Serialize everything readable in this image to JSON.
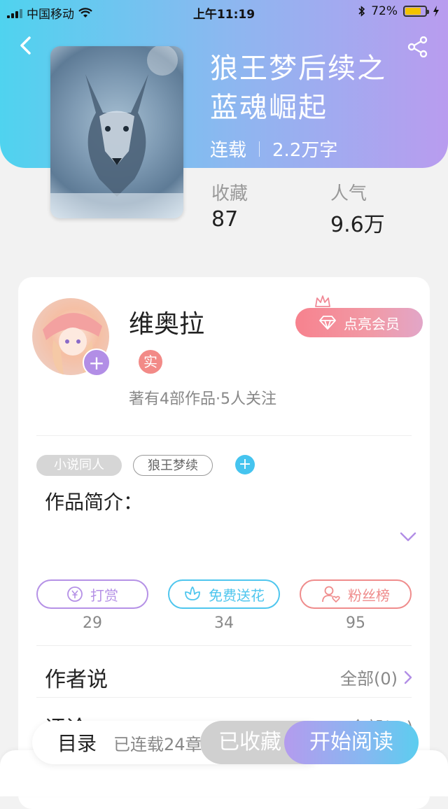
{
  "status_bar": {
    "carrier": "中国移动",
    "time": "上午11:19",
    "battery": "72%"
  },
  "book": {
    "title_line1": "狼王梦后续之",
    "title_line2": "蓝魂崛起",
    "status": "连载",
    "word_count": "2.2万字",
    "favorites_label": "收藏",
    "favorites_value": "87",
    "popularity_label": "人气",
    "popularity_value": "9.6万"
  },
  "author": {
    "name": "维奥拉",
    "verified_badge": "实",
    "info": "著有4部作品·5人关注",
    "vip_button": "点亮会员"
  },
  "tags": [
    "小说同人",
    "狼王梦续"
  ],
  "intro": {
    "title": "作品简介："
  },
  "actions": [
    {
      "label": "打赏",
      "count": "29",
      "color": "#b591e6"
    },
    {
      "label": "免费送花",
      "count": "34",
      "color": "#4fc6ee"
    },
    {
      "label": "粉丝榜",
      "count": "95",
      "color": "#ef8c8c"
    }
  ],
  "author_says": {
    "title": "作者说",
    "all": "全部(0)"
  },
  "comments": {
    "title": "评论",
    "all": "全部(…)"
  },
  "bottom": {
    "toc": "目录",
    "serial_status": "已连载24章",
    "collected": "已收藏",
    "start_reading": "开始阅读"
  },
  "colors": {
    "header_start": "#4fd3ef",
    "header_end": "#b99cef",
    "accent_purple": "#b28ee6"
  }
}
